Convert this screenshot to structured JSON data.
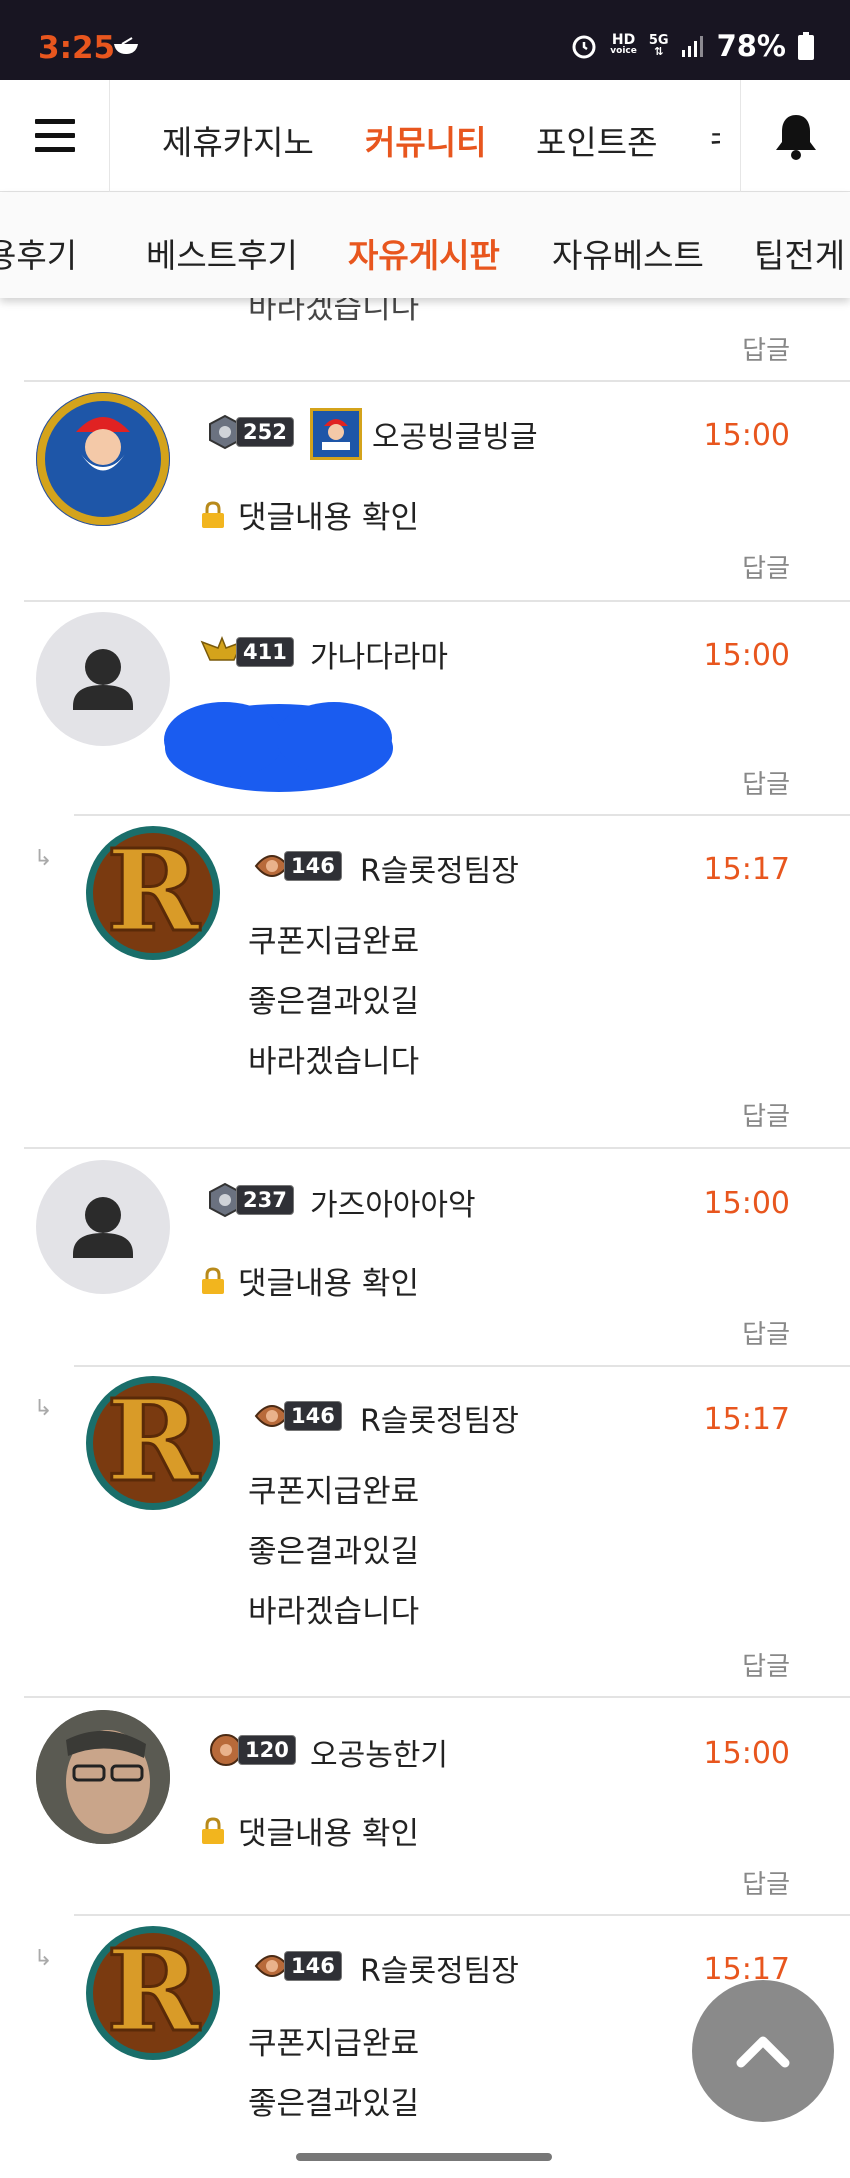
{
  "status": {
    "time": "3:25",
    "battery": "78%",
    "hd_top": "HD",
    "hd_bottom": "voice",
    "net": "5G"
  },
  "topnav": {
    "tabs": [
      "제휴카지노",
      "커뮤니티",
      "포인트존",
      "ㅋ"
    ],
    "active": "커뮤니티"
  },
  "subnav": {
    "tabs": [
      "용후기",
      "베스트후기",
      "자유게시판",
      "자유베스트",
      "팁전게"
    ],
    "active": "자유게시판"
  },
  "reply_label": "답글",
  "partial_text": "바라겠습니다",
  "comments": [
    {
      "level": "252",
      "nick": "오공빙글빙글",
      "time": "15:00",
      "locked_text": "댓글내용 확인"
    },
    {
      "level": "411",
      "nick": "가나다라마",
      "time": "15:00"
    },
    {
      "level": "146",
      "nick": "R슬롯정팀장",
      "time": "15:17",
      "lines": [
        "쿠폰지급완료",
        "좋은결과있길",
        "바라겠습니다"
      ]
    },
    {
      "level": "237",
      "nick": "가즈아아아악",
      "time": "15:00",
      "locked_text": "댓글내용 확인"
    },
    {
      "level": "146",
      "nick": "R슬롯정팀장",
      "time": "15:17",
      "lines": [
        "쿠폰지급완료",
        "좋은결과있길",
        "바라겠습니다"
      ]
    },
    {
      "level": "120",
      "nick": "오공농한기",
      "time": "15:00",
      "locked_text": "댓글내용 확인"
    },
    {
      "level": "146",
      "nick": "R슬롯정팀장",
      "time": "15:17",
      "lines": [
        "쿠폰지급완료",
        "좋은결과있길"
      ]
    }
  ],
  "colors": {
    "accent": "#e8561e",
    "statusbar": "#181522",
    "blob": "#1a5cf0"
  }
}
